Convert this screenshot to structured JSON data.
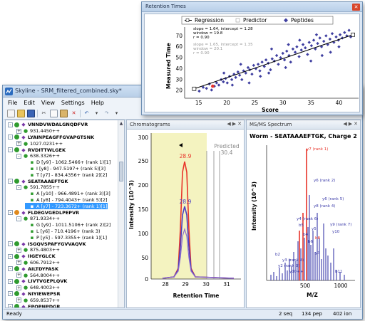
{
  "main_window": {
    "title": "Skyline - SRM_filtered_combined.sky*",
    "menu": [
      "File",
      "Edit",
      "View",
      "Settings",
      "Help"
    ],
    "status": {
      "left": "Ready",
      "seq": "2 seq",
      "pep": "134 pep",
      "ion": "402 ion"
    }
  },
  "tree": [
    {
      "indent": 0,
      "expander": "-",
      "kind": "peptide",
      "color": "#2f9b2f",
      "text": "VNNDVWDALGNQDFVR"
    },
    {
      "indent": 1,
      "expander": "+",
      "kind": "precursor",
      "text": "931.4450++"
    },
    {
      "indent": 0,
      "expander": "-",
      "kind": "peptide",
      "color": "#2f9b2f",
      "text": "LYAINPEAGFFGVAPGTSNK"
    },
    {
      "indent": 1,
      "expander": "+",
      "kind": "precursor",
      "text": "1027.0231++"
    },
    {
      "indent": 0,
      "expander": "-",
      "kind": "peptide",
      "color": "#2f9b2f",
      "text": "RVDITTWLGEK"
    },
    {
      "indent": 1,
      "expander": "-",
      "kind": "precursor",
      "text": "638.3326++"
    },
    {
      "indent": 2,
      "kind": "transition",
      "text": "D [y9] - 1062.5466+ (rank 1)[1]"
    },
    {
      "indent": 2,
      "kind": "transition",
      "text": "I [y8] - 947.5197+ (rank 5)[3]"
    },
    {
      "indent": 2,
      "kind": "transition",
      "text": "T [y7] - 834.4356+ (rank 2)[2]"
    },
    {
      "indent": 0,
      "expander": "-",
      "kind": "peptide",
      "color": "#2f9b2f",
      "text": "SEATAAAEFTGK"
    },
    {
      "indent": 1,
      "expander": "-",
      "kind": "precursor",
      "text": "591.7855++"
    },
    {
      "indent": 2,
      "kind": "transition",
      "text": "A [y10] - 966.4891+ (rank 3)[3]"
    },
    {
      "indent": 2,
      "kind": "transition",
      "text": "A [y8] - 794.4043+ (rank 5)[2]"
    },
    {
      "indent": 2,
      "kind": "transition",
      "text": "A [y7] - 723.3672+ (rank 1)[1]",
      "selected": true
    },
    {
      "indent": 0,
      "expander": "-",
      "kind": "peptide",
      "color": "#e08a1e",
      "text": "FLDEGVGEDLPEPVR"
    },
    {
      "indent": 1,
      "expander": "-",
      "kind": "precursor",
      "text": "871.9334++"
    },
    {
      "indent": 2,
      "kind": "transition",
      "text": "G [y9] - 1011.5106+ (rank 2)[2]"
    },
    {
      "indent": 2,
      "kind": "transition",
      "text": "L [y6] - 710.4196+ (rank 3)"
    },
    {
      "indent": 2,
      "kind": "transition",
      "text": "P [y5] - 597.3355+ (rank 1)[1]"
    },
    {
      "indent": 0,
      "expander": "-",
      "kind": "peptide",
      "color": "#2f9b2f",
      "text": "ISGQVSPAFYGVVAQVK"
    },
    {
      "indent": 1,
      "expander": "+",
      "kind": "precursor",
      "text": "875.4803++"
    },
    {
      "indent": 0,
      "expander": "-",
      "kind": "peptide",
      "color": "#2f9b2f",
      "text": "IIGEYGLCK"
    },
    {
      "indent": 1,
      "expander": "+",
      "kind": "precursor",
      "text": "606.7912++"
    },
    {
      "indent": 0,
      "expander": "-",
      "kind": "peptide",
      "color": "#2f9b2f",
      "text": "AILTDYFASK"
    },
    {
      "indent": 1,
      "expander": "+",
      "kind": "precursor",
      "text": "564.8004++"
    },
    {
      "indent": 0,
      "expander": "-",
      "kind": "peptide",
      "color": "#2f9b2f",
      "text": "LIVTVGEPLQVK"
    },
    {
      "indent": 1,
      "expander": "+",
      "kind": "precursor",
      "text": "648.4003++"
    },
    {
      "indent": 0,
      "expander": "-",
      "kind": "peptide",
      "color": "#2f9b2f",
      "text": "NIYIEWEPSR"
    },
    {
      "indent": 1,
      "expander": "+",
      "kind": "precursor",
      "text": "659.8537++"
    },
    {
      "indent": 0,
      "expander": "-",
      "kind": "peptide",
      "color": "#2f9b2f",
      "text": "EPQPNPDGR"
    }
  ],
  "chromatogram": {
    "title": "Chromatograms",
    "xlabel": "Retention Time",
    "ylabel": "Intensity (10^3)",
    "xticks": [
      "28",
      "29",
      "30",
      "31"
    ],
    "yticks": [
      "0",
      "50",
      "100",
      "150",
      "200",
      "250",
      "300"
    ],
    "peak_labels": [
      "28.9",
      "28.9"
    ],
    "predicted_label": "Predicted",
    "predicted_value": "30.4",
    "colors": {
      "red": "#e8342a",
      "blue": "#4b3fbf",
      "purple": "#8c6ad0",
      "highlight": "#f4f3c0"
    }
  },
  "spectrum": {
    "tab": "MS/MS Spectrum",
    "title": "Worm - SEATAAAEFTGK, Charge 2",
    "xlabel": "M/Z",
    "ylabel": "Intensity (10^3)",
    "xticks": [
      "500",
      "1000"
    ],
    "ion_labels": [
      "y7 (rank 1)",
      "y6 (rank 2)",
      "y6 (rank 5)",
      "y8 (rank 4)",
      "y4 (rank 6)",
      "b5",
      "y5",
      "b4",
      "y9 (rank 7)",
      "b8",
      "y10",
      "b2",
      "y3 (rank 8)",
      "b6",
      "y2 (rank 9)",
      "y3",
      "y10++",
      "b11"
    ]
  },
  "rt_window": {
    "title": "Retention Times",
    "legend": [
      "Regression",
      "Predictor",
      "Peptides"
    ],
    "stats_top": [
      "slope = 1.64, intercept = 1.28",
      "window = 19.8",
      "r = 0.90"
    ],
    "stats_bottom": [
      "slope = 1.65, intercept = 1.35",
      "window = 20.1",
      "r = 0.90"
    ],
    "xlabel": "Score",
    "ylabel": "Measured Time",
    "xticks": [
      "15",
      "20",
      "25",
      "30",
      "35",
      "40"
    ],
    "yticks": [
      "20",
      "30",
      "40",
      "50",
      "60",
      "70"
    ]
  },
  "chart_data": {
    "type": "scatter",
    "title": "Retention Times",
    "xlabel": "Score",
    "ylabel": "Measured Time",
    "xlim": [
      12.5,
      43.5
    ],
    "ylim": [
      13,
      78
    ],
    "regression": {
      "slope": 1.64,
      "intercept": 1.28
    },
    "points": [
      [
        14.2,
        21
      ],
      [
        15.1,
        19.5
      ],
      [
        15.8,
        23
      ],
      [
        16.4,
        22
      ],
      [
        16.9,
        26
      ],
      [
        17.3,
        20.5
      ],
      [
        17.8,
        24
      ],
      [
        18.2,
        27
      ],
      [
        18.6,
        25
      ],
      [
        19.0,
        30
      ],
      [
        19.4,
        28
      ],
      [
        19.8,
        31
      ],
      [
        20.1,
        27
      ],
      [
        20.5,
        33
      ],
      [
        20.9,
        30
      ],
      [
        21.3,
        35
      ],
      [
        21.6,
        32
      ],
      [
        22.0,
        37
      ],
      [
        22.3,
        34
      ],
      [
        22.7,
        30
      ],
      [
        23.0,
        38
      ],
      [
        23.4,
        36
      ],
      [
        23.8,
        41
      ],
      [
        24.1,
        39
      ],
      [
        24.5,
        35
      ],
      [
        24.8,
        43
      ],
      [
        25.2,
        40
      ],
      [
        25.6,
        44
      ],
      [
        25.9,
        38
      ],
      [
        26.3,
        46
      ],
      [
        26.7,
        42
      ],
      [
        27.0,
        48
      ],
      [
        27.4,
        45
      ],
      [
        27.8,
        39
      ],
      [
        28.1,
        49
      ],
      [
        28.5,
        47
      ],
      [
        28.9,
        52
      ],
      [
        29.2,
        44
      ],
      [
        29.6,
        50
      ],
      [
        30.0,
        54
      ],
      [
        30.3,
        48
      ],
      [
        30.7,
        56
      ],
      [
        31.1,
        52
      ],
      [
        31.4,
        46
      ],
      [
        31.8,
        58
      ],
      [
        32.2,
        55
      ],
      [
        32.5,
        60
      ],
      [
        32.9,
        51
      ],
      [
        33.3,
        57
      ],
      [
        33.6,
        62
      ],
      [
        34.0,
        59
      ],
      [
        34.4,
        53
      ],
      [
        34.7,
        64
      ],
      [
        35.1,
        61
      ],
      [
        35.5,
        66
      ],
      [
        35.8,
        58
      ],
      [
        36.2,
        63
      ],
      [
        36.6,
        68
      ],
      [
        36.9,
        60
      ],
      [
        37.3,
        65
      ],
      [
        37.7,
        70
      ],
      [
        38.0,
        62
      ],
      [
        38.4,
        67
      ],
      [
        38.8,
        72
      ],
      [
        39.1,
        64
      ],
      [
        39.5,
        69
      ],
      [
        39.9,
        66
      ],
      [
        40.2,
        71
      ],
      [
        40.6,
        68
      ],
      [
        41.0,
        73
      ],
      [
        41.4,
        70
      ],
      [
        41.8,
        75
      ],
      [
        42.1,
        69
      ],
      [
        22.5,
        44
      ],
      [
        26.0,
        33
      ],
      [
        30.5,
        41
      ],
      [
        35.0,
        47
      ],
      [
        38.5,
        55
      ],
      [
        19.5,
        36
      ],
      [
        28.0,
        58
      ],
      [
        33.0,
        66
      ],
      [
        24.0,
        27
      ],
      [
        37.0,
        52
      ],
      [
        31.0,
        62
      ],
      [
        27.5,
        36
      ],
      [
        21.0,
        25
      ],
      [
        36.0,
        71
      ],
      [
        40.0,
        60
      ]
    ],
    "predictor_point": [
      17.5,
      24
    ],
    "regression_endpoints": [
      [
        14.2,
        21.6
      ],
      [
        42.5,
        71.0
      ]
    ]
  }
}
